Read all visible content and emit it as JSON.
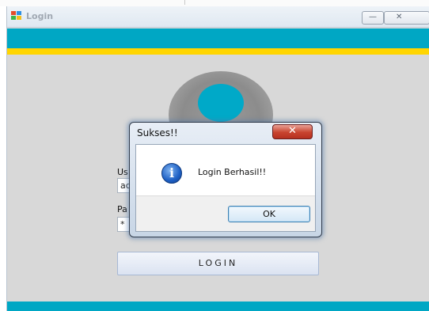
{
  "window": {
    "title": "Login",
    "minimize_glyph": "—",
    "close_glyph": "✕"
  },
  "form": {
    "username_label": "Us",
    "username_value": "ad",
    "password_label": "Pa",
    "password_value": "*",
    "login_button_label": "LOGIN"
  },
  "dialog": {
    "title": "Sukses!!",
    "close_glyph": "✕",
    "icon": "information-icon",
    "icon_glyph": "i",
    "message": "Login Berhasil!!",
    "ok_label": "OK"
  },
  "colors": {
    "teal": "#00a7c4",
    "yellow": "#ffd500",
    "background": "#d8d8d8"
  }
}
